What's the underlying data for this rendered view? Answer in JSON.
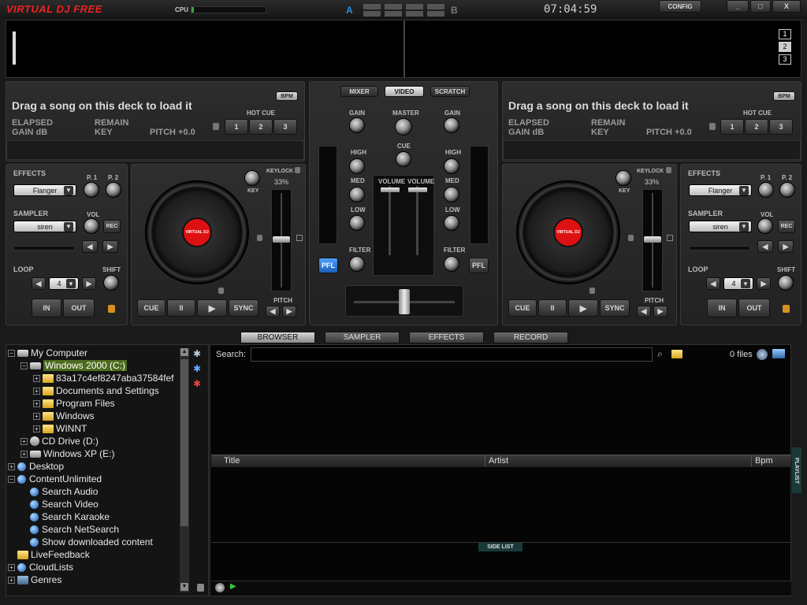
{
  "app": {
    "logo": "VIRTUAL DJ FREE",
    "cpu_label": "CPU",
    "clock": "07:04:59",
    "config": "CONFIG",
    "min": "_",
    "max": "□",
    "close": "X",
    "deck_a_letter": "A",
    "deck_b_letter": "B"
  },
  "waveform": {
    "zoom_buttons": [
      "1",
      "2",
      "3"
    ]
  },
  "deck_left": {
    "title": "Drag a song on this deck to load it",
    "bpm": "BPM",
    "elapsed": "ELAPSED",
    "remain": "REMAIN",
    "gain_db": "GAIN dB",
    "key": "KEY",
    "pitch": "PITCH +0.0",
    "hot_cue": "HOT CUE",
    "hot_cues": [
      "1",
      "2",
      "3"
    ],
    "effects_label": "EFFECTS",
    "effect": "Flanger",
    "p1": "P. 1",
    "p2": "P. 2",
    "sampler_label": "SAMPLER",
    "sample": "siren",
    "vol": "VOL",
    "rec": "REC",
    "loop_label": "LOOP",
    "loop_value": "4",
    "shift": "SHIFT",
    "in": "IN",
    "out": "OUT",
    "keylock": "KEYLOCK",
    "keylock_pct": "33%",
    "key_knob": "KEY",
    "pitch_label": "PITCH",
    "cue": "CUE",
    "pause": "II",
    "play": "▶",
    "sync": "SYNC",
    "platter_label": "VIRTUAL DJ"
  },
  "deck_right": {
    "title": "Drag a song on this deck to load it",
    "bpm": "BPM",
    "elapsed": "ELAPSED",
    "remain": "REMAIN",
    "gain_db": "GAIN dB",
    "key": "KEY",
    "pitch": "PITCH +0.0",
    "hot_cue": "HOT CUE",
    "hot_cues": [
      "1",
      "2",
      "3"
    ],
    "effects_label": "EFFECTS",
    "effect": "Flanger",
    "p1": "P. 1",
    "p2": "P. 2",
    "sampler_label": "SAMPLER",
    "sample": "siren",
    "vol": "VOL",
    "rec": "REC",
    "loop_label": "LOOP",
    "loop_value": "4",
    "shift": "SHIFT",
    "in": "IN",
    "out": "OUT",
    "keylock": "KEYLOCK",
    "keylock_pct": "33%",
    "key_knob": "KEY",
    "pitch_label": "PITCH",
    "cue": "CUE",
    "pause": "II",
    "play": "▶",
    "sync": "SYNC",
    "platter_label": "VIRTUAL DJ"
  },
  "mixer": {
    "tabs": [
      "MIXER",
      "VIDEO",
      "SCRATCH"
    ],
    "gain": "GAIN",
    "master": "MASTER",
    "cue": "CUE",
    "high": "HIGH",
    "med": "MED",
    "low": "LOW",
    "volume": "VOLUME",
    "filter": "FILTER",
    "pfl": "PFL"
  },
  "browser_tabs": [
    "BROWSER",
    "SAMPLER",
    "EFFECTS",
    "RECORD"
  ],
  "tree": [
    "My Computer",
    "Windows 2000 (C:)",
    "83a17c4ef8247aba37584fef",
    "Documents and Settings",
    "Program Files",
    "Windows",
    "WINNT",
    "CD Drive (D:)",
    "Windows XP (E:)",
    "Desktop",
    "ContentUnlimited",
    "Search Audio",
    "Search Video",
    "Search Karaoke",
    "Search NetSearch",
    "Show downloaded content",
    "LiveFeedback",
    "CloudLists",
    "Genres"
  ],
  "search": {
    "label": "Search:",
    "value": "",
    "files": "0 files"
  },
  "columns": [
    "Title",
    "Artist",
    "Bpm"
  ],
  "side_list": "SIDE LIST",
  "playlist": "PLAYLIST"
}
